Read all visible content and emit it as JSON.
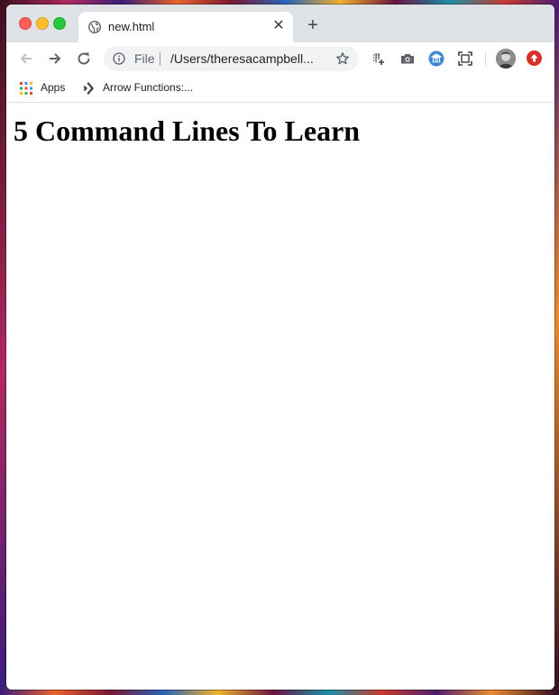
{
  "tab": {
    "title": "new.html"
  },
  "omnibox": {
    "site_label": "File",
    "url": "/Users/theresacampbell..."
  },
  "bookmarks": [
    {
      "label": "Apps",
      "icon": "apps-grid-icon"
    },
    {
      "label": "Arrow Functions:...",
      "icon": "bookmark-favicon-icon"
    }
  ],
  "page": {
    "heading": "5 Command Lines To Learn"
  },
  "colors": {
    "tabstrip": "#dee1e6",
    "close": "#ff5f57",
    "minimize": "#febc2e",
    "zoom": "#28c840",
    "update_badge": "#d93025"
  }
}
